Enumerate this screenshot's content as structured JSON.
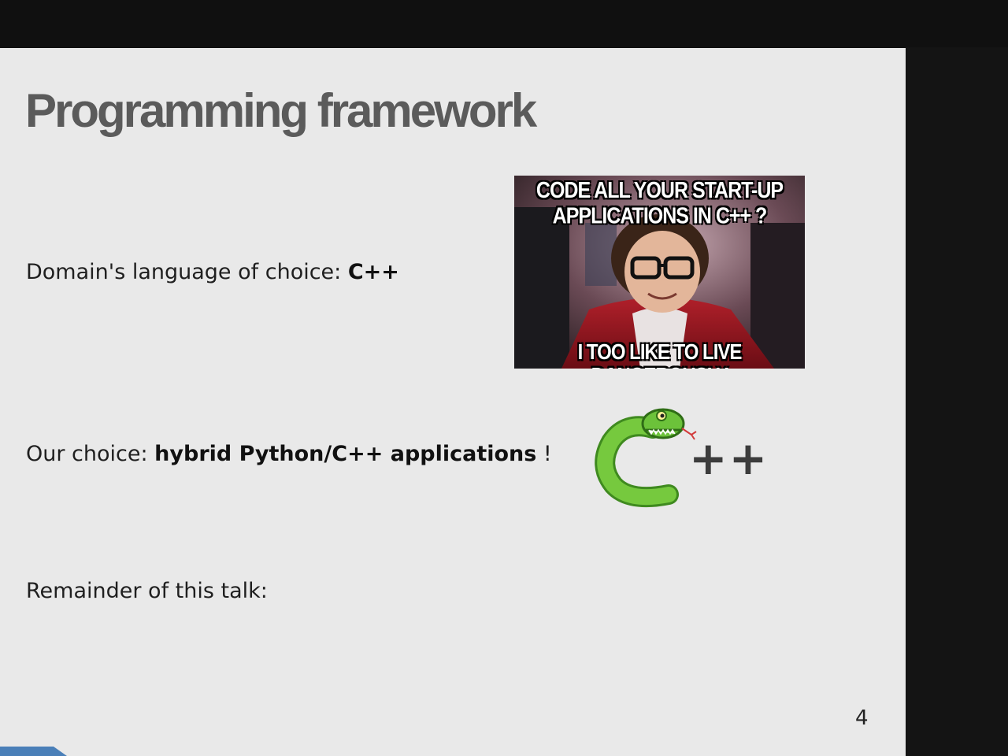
{
  "slide": {
    "title": "Programming framework",
    "bullets": [
      {
        "prefix": "Domain's language of choice: ",
        "bold": "C++",
        "suffix": ""
      },
      {
        "prefix": "Our choice: ",
        "bold": "hybrid Python/C++ applications",
        "suffix": " !"
      },
      {
        "prefix": "Remainder of this talk:",
        "bold": "",
        "suffix": ""
      }
    ],
    "meme": {
      "top_line_1": "CODE ALL YOUR START-UP",
      "top_line_2": "APPLICATIONS IN C++ ?",
      "bottom_line": "I TOO LIKE TO LIVE DANGEROUSLY"
    },
    "logo": {
      "icon": "snake-c-logo-icon",
      "plus_text": "++"
    },
    "page_number": "4"
  },
  "colors": {
    "slide_background": "#e9e9e9",
    "title": "#5b5b5b",
    "text": "#1f1f1f",
    "snake_green": "#6cc23a",
    "accent_tab": "#4a7fb8",
    "outer_background": "#101010"
  }
}
